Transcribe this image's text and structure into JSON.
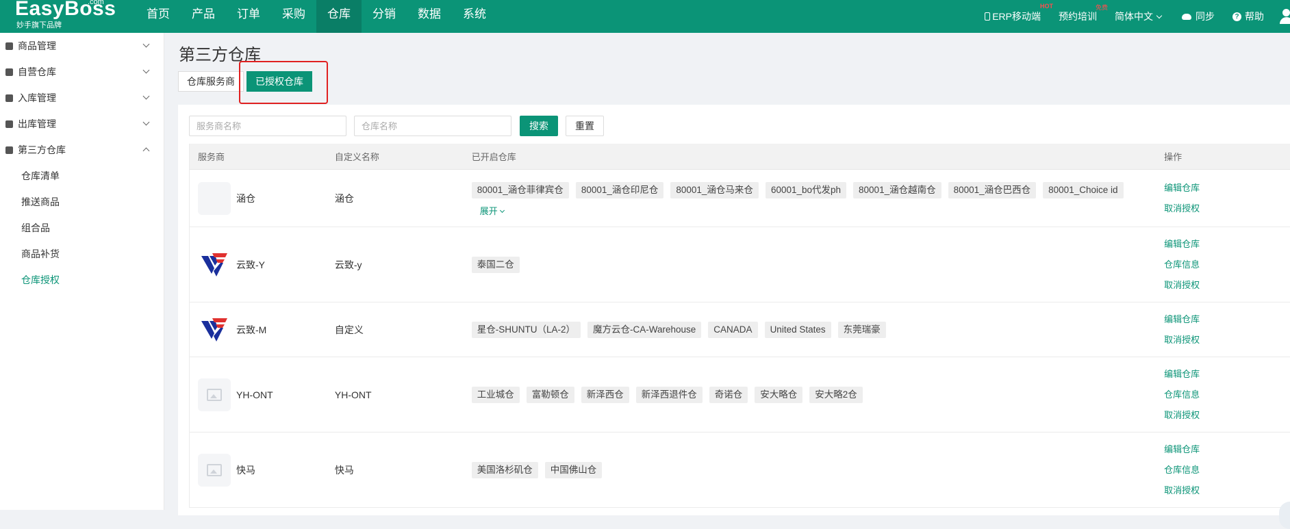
{
  "brand": {
    "name": "EasyBoss",
    "com": ".com",
    "tagline": "妙手旗下品牌"
  },
  "nav": [
    "首页",
    "产品",
    "订单",
    "采购",
    "仓库",
    "分销",
    "数据",
    "系统"
  ],
  "nav_active_index": 4,
  "top_right": {
    "erp_mobile": "ERP移动端",
    "erp_badge": "HOT",
    "training": "预约培训",
    "training_badge": "免费",
    "language": "简体中文",
    "sync": "同步",
    "help": "帮助"
  },
  "sidebar": {
    "groups": [
      "商品管理",
      "自营仓库",
      "入库管理",
      "出库管理",
      "第三方仓库"
    ],
    "sub_items": [
      "仓库清单",
      "推送商品",
      "组合品",
      "商品补货",
      "仓库授权"
    ],
    "active_sub": "仓库授权"
  },
  "page": {
    "title": "第三方仓库",
    "tabs": [
      "仓库服务商",
      "已授权仓库"
    ],
    "active_tab": "已授权仓库"
  },
  "filters": {
    "provider_placeholder": "服务商名称",
    "warehouse_placeholder": "仓库名称",
    "search": "搜索",
    "reset": "重置"
  },
  "table": {
    "headers": [
      "服务商",
      "自定义名称",
      "已开启仓库",
      "操作"
    ],
    "expand_label": "展开",
    "rows": [
      {
        "provider": "涵仓",
        "custom_name": "涵仓",
        "logo": "blank",
        "warehouses": [
          "80001_涵仓菲律宾仓",
          "80001_涵仓印尼仓",
          "80001_涵仓马来仓",
          "60001_bo代发ph",
          "80001_涵仓越南仓",
          "80001_涵仓巴西仓",
          "80001_Choice id"
        ],
        "expandable": true,
        "actions": [
          "编辑仓库",
          "取消授权"
        ]
      },
      {
        "provider": "云致-Y",
        "custom_name": "云致-y",
        "logo": "yunzhi",
        "warehouses": [
          "泰国二仓"
        ],
        "expandable": false,
        "actions": [
          "编辑仓库",
          "仓库信息",
          "取消授权"
        ]
      },
      {
        "provider": "云致-M",
        "custom_name": "自定义",
        "logo": "yunzhi",
        "warehouses": [
          "星仓-SHUNTU（LA-2）",
          "魔方云仓-CA-Warehouse",
          "CANADA",
          "United States",
          "东莞瑞豪"
        ],
        "expandable": false,
        "actions": [
          "编辑仓库",
          "取消授权"
        ]
      },
      {
        "provider": "YH-ONT",
        "custom_name": "YH-ONT",
        "logo": "placeholder",
        "warehouses": [
          "工业城仓",
          "富勒顿仓",
          "新泽西仓",
          "新泽西退件仓",
          "奇诺仓",
          "安大略仓",
          "安大略2仓"
        ],
        "expandable": false,
        "actions": [
          "编辑仓库",
          "仓库信息",
          "取消授权"
        ]
      },
      {
        "provider": "快马",
        "custom_name": "快马",
        "logo": "placeholder",
        "warehouses": [
          "美国洛杉矶仓",
          "中国佛山仓"
        ],
        "expandable": false,
        "actions": [
          "编辑仓库",
          "仓库信息",
          "取消授权"
        ]
      }
    ]
  },
  "colors": {
    "primary": "#0b9477",
    "nav_active": "#0a7e66",
    "highlight": "#e02020",
    "logo_blue": "#1a2f9c",
    "logo_red": "#e0312f"
  }
}
